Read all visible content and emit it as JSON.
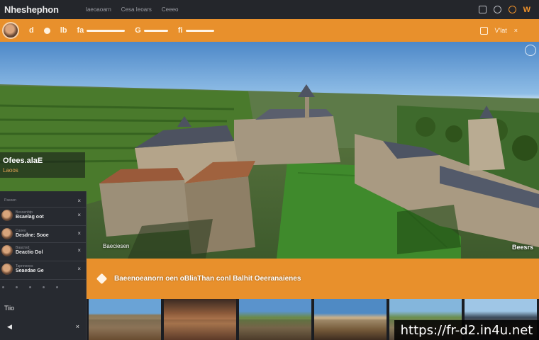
{
  "app": {
    "title": "Nheshephon",
    "nav": [
      "Iaeoaoarn",
      "Cesa Ieoars",
      "Ceeeo"
    ]
  },
  "topbar": {
    "icons": [
      "phone-icon",
      "clock-icon",
      "circle-icon",
      "brand-mark-icon"
    ],
    "brandmark": "W"
  },
  "toolbar": {
    "items": [
      {
        "glyph": "d",
        "label": ""
      },
      {
        "glyph": "G",
        "label": ""
      },
      {
        "glyph": "lb",
        "label": ""
      },
      {
        "glyph": "fa",
        "label": ""
      },
      {
        "glyph": "G",
        "label": ""
      },
      {
        "glyph": "fi",
        "label": ""
      }
    ],
    "right_label": "V'lat",
    "right_close": "×"
  },
  "hero": {
    "tag_title": "Ofees.alaE",
    "tag_sub": "Laoos",
    "caption_left": "Baeciesen",
    "caption_right": "Beesrs"
  },
  "panel": {
    "header": "Pasoen",
    "header_close": "×",
    "rows": [
      {
        "name": "Bsaelag oot",
        "sub": "Besoenbtp",
        "close": "×"
      },
      {
        "name": "Desdne: Sooe",
        "sub": "Caoeo",
        "close": "×"
      },
      {
        "name": "Deactio Dol",
        "sub": "Baacnsd",
        "close": "×"
      },
      {
        "name": "Seaedae Ge",
        "sub": "Tapnneeos",
        "close": "×"
      },
      {
        "name": "",
        "sub": "",
        "close": ""
      }
    ],
    "title": "Tiio",
    "prev": "◀",
    "next": "×"
  },
  "infobar": {
    "text": "Baeenoeanorn oen oBliaThan conl Balhit Oeeranaienes"
  },
  "thumbnails": [
    "thumb-1",
    "thumb-2",
    "thumb-3",
    "thumb-4",
    "thumb-5",
    "thumb-6"
  ],
  "watermark": "https://fr-d2.in4u.net",
  "colors": {
    "accent": "#e8902c",
    "dark": "#24262b",
    "panel": "#272a30"
  }
}
